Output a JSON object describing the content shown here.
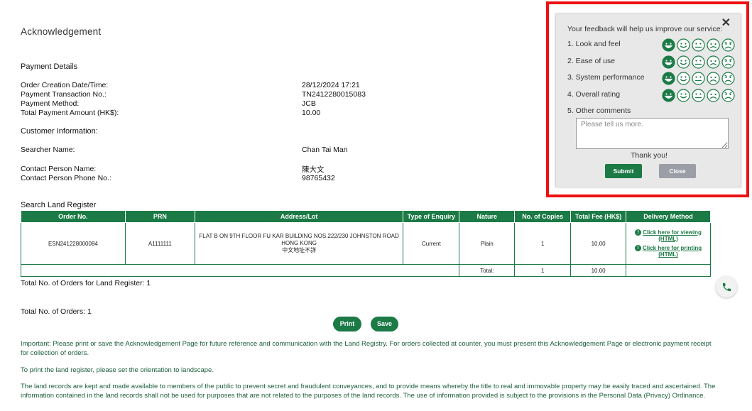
{
  "page": {
    "title": "Acknowledgement"
  },
  "payment": {
    "section_title": "Payment Details",
    "rows": [
      {
        "label": "Order Creation Date/Time:",
        "value": "28/12/2024 17:21"
      },
      {
        "label": "Payment Transaction No.:",
        "value": "TN2412280015083"
      },
      {
        "label": "Payment Method:",
        "value": "JCB"
      },
      {
        "label": "Total Payment Amount (HK$):",
        "value": "10.00"
      }
    ]
  },
  "customer": {
    "section_title": "Customer Information:",
    "searcher_label": "Searcher Name:",
    "searcher_value": "Chan Tai Man",
    "contact_name_label": "Contact Person Name:",
    "contact_name_value": "陳大文",
    "contact_phone_label": "Contact Person Phone No.:",
    "contact_phone_value": "98765432"
  },
  "land_register": {
    "section_title": "Search Land Register",
    "columns": [
      "Order No.",
      "PRN",
      "Address/Lot",
      "Type of Enquiry",
      "Nature",
      "No. of Copies",
      "Total Fee (HK$)",
      "Delivery Method"
    ],
    "rows": [
      {
        "order_no": "ESN241228000084",
        "prn": "A1111111",
        "address_line1": "FLAT B ON 9TH FLOOR FU KAR BUILDING NOS.222/230 JOHNSTON ROAD",
        "address_line2": "HONG KONG",
        "address_line3": "中文地址不詳",
        "type_of_enquiry": "Current",
        "nature": "Plain",
        "copies": "1",
        "fee": "10.00",
        "link_view": "Click here for viewing (HTML)",
        "link_print": "Click here for printing (HTML)"
      }
    ],
    "total_row": {
      "label": "Total:",
      "copies": "1",
      "fee": "10.00"
    },
    "total_orders_text": "Total No. of Orders for Land Register: 1"
  },
  "summary": {
    "total_orders_text": "Total No. of Orders: 1"
  },
  "actions": {
    "print_label": "Print",
    "save_label": "Save"
  },
  "notices": {
    "important": "Important: Please print or save the Acknowledgement Page for future reference and communication with the Land Registry. For orders collected at counter, you must present this Acknowledgement Page or electronic payment receipt for collection of orders.",
    "orientation": "To print the land register, please set the orientation to landscape.",
    "disclaimer": "The land records are kept and made available to members of the public to prevent secret and fraudulent conveyances, and to provide means whereby the title to real and immovable property may be easily traced and ascertained. The information contained in the land records shall not be used for purposes that are not related to the purposes of the land records. The use of information provided is subject to the provisions in the Personal Data (Privacy) Ordinance."
  },
  "feedback": {
    "intro": "Your feedback will help us improve our service:",
    "questions": [
      {
        "label": "1. Look and feel",
        "selected": 1
      },
      {
        "label": "2. Ease of use",
        "selected": 1
      },
      {
        "label": "3. System performance",
        "selected": 1
      },
      {
        "label": "4. Overall rating",
        "selected": 1
      }
    ],
    "comments_label": "5. Other comments",
    "comments_placeholder": "Please tell us more.",
    "thanks": "Thank you!",
    "submit_label": "Submit",
    "close_label": "Close",
    "face_icons": [
      "very-happy-face-icon",
      "happy-face-icon",
      "neutral-face-icon",
      "sad-face-icon",
      "very-sad-face-icon"
    ]
  },
  "colors": {
    "brand_green": "#1b7a45",
    "highlight_red": "#ee1111",
    "close_grey": "#9b9ea6"
  }
}
